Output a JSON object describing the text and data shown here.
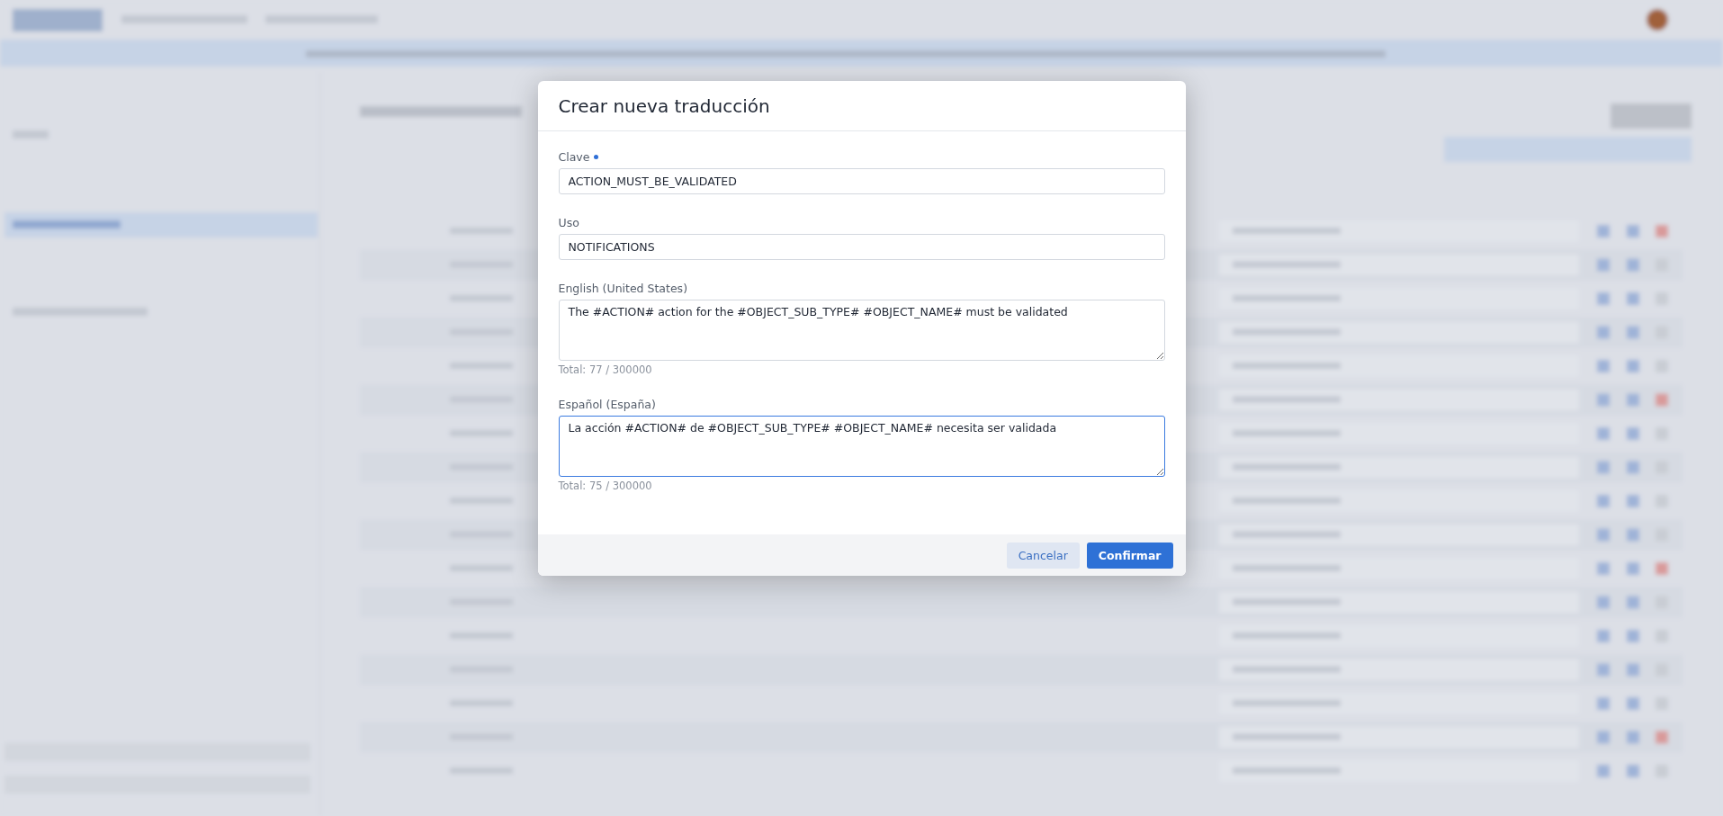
{
  "dialog": {
    "title": "Crear nueva traducción",
    "fields": [
      {
        "kind": "input",
        "label": "Clave",
        "required": true,
        "value": "ACTION_MUST_BE_VALIDATED",
        "focused": false
      },
      {
        "kind": "input",
        "label": "Uso",
        "required": false,
        "value": "NOTIFICATIONS",
        "focused": false
      },
      {
        "kind": "textarea",
        "label": "English (United States)",
        "required": false,
        "value": "The #ACTION# action for the #OBJECT_SUB_TYPE# #OBJECT_NAME# must be validated",
        "counter": "Total: 77 / 300000",
        "focused": false
      },
      {
        "kind": "textarea",
        "label": "Español (España)",
        "required": false,
        "value": "La acción #ACTION# de #OBJECT_SUB_TYPE# #OBJECT_NAME# necesita ser validada",
        "counter": "Total: 75 / 300000",
        "focused": true
      }
    ],
    "buttons": [
      {
        "kind": "secondary",
        "label": "Cancelar"
      },
      {
        "kind": "primary",
        "label": "Confirmar"
      }
    ]
  }
}
